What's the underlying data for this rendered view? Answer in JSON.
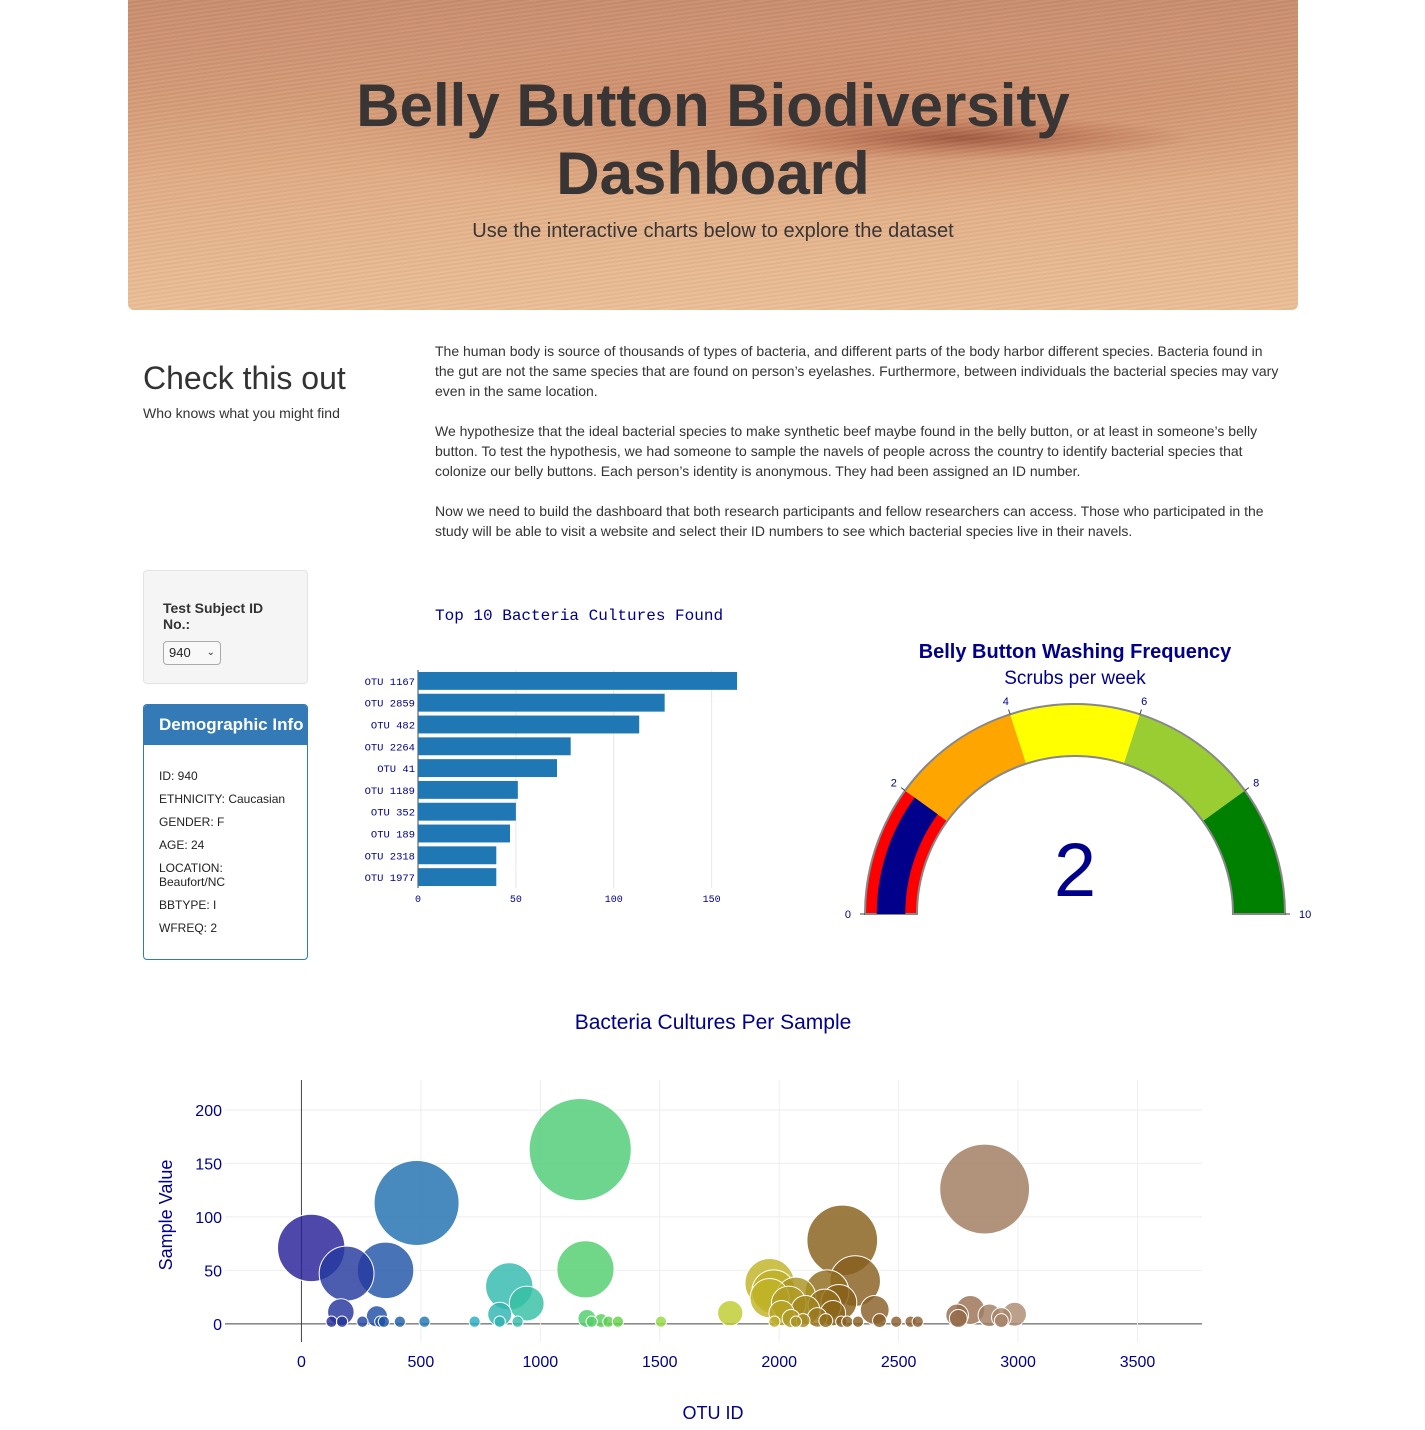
{
  "hero": {
    "title_line1": "Belly Button Biodiversity",
    "title_line2": "Dashboard",
    "subtitle": "Use the interactive charts below to explore the dataset"
  },
  "intro": {
    "heading": "Check this out",
    "subheading": "Who knows what you might find",
    "paragraphs": [
      "The human body is source of thousands of types of bacteria, and different parts of the body harbor different species. Bacteria found in the gut are not the same species that are found on person’s eyelashes. Furthermore, between individuals the bacterial species may vary even in the same location.",
      "We hypothesize that the ideal bacterial species to make synthetic beef maybe found in the belly button, or at least in someone’s belly button. To test the hypothesis, we had someone to sample the navels of people across the country to identify bacterial species that colonize our belly buttons. Each person’s identity is anonymous. They had been assigned an ID number.",
      "Now we need to build the dashboard that both research participants and fellow researchers can access. Those who participated in the study will be able to visit a website and select their ID numbers to see which bacterial species live in their navels."
    ]
  },
  "selector": {
    "label": "Test Subject ID No.:",
    "selected": "940"
  },
  "demographics": {
    "title": "Demographic Info",
    "items": [
      "ID: 940",
      "ETHNICITY: Caucasian",
      "GENDER: F",
      "AGE: 24",
      "LOCATION: Beaufort/NC",
      "BBTYPE: I",
      "WFREQ: 2"
    ]
  },
  "colors": {
    "bar": "#1f77b4",
    "chart_title": "#00008b",
    "panel": "#337ab7"
  },
  "chart_data": [
    {
      "type": "bar",
      "orientation": "horizontal",
      "title": "Top 10 Bacteria Cultures Found",
      "categories": [
        "OTU 1167",
        "OTU 2859",
        "OTU 482",
        "OTU 2264",
        "OTU 41",
        "OTU 1189",
        "OTU 352",
        "OTU 189",
        "OTU 2318",
        "OTU 1977"
      ],
      "values": [
        163,
        126,
        113,
        78,
        71,
        51,
        50,
        47,
        40,
        40
      ],
      "xlim": [
        0,
        165
      ],
      "xticks": [
        0,
        50,
        100,
        150
      ]
    },
    {
      "type": "gauge",
      "title": "Belly Button Washing Frequency",
      "subtitle": "Scrubs per week",
      "value": 2,
      "range": [
        0,
        10
      ],
      "ticks": [
        0,
        2,
        4,
        6,
        8,
        10
      ],
      "steps": [
        {
          "range": [
            0,
            2
          ],
          "color": "#ff0000"
        },
        {
          "range": [
            2,
            4
          ],
          "color": "#ffa500"
        },
        {
          "range": [
            4,
            6
          ],
          "color": "#ffff00"
        },
        {
          "range": [
            6,
            8
          ],
          "color": "#9acd32"
        },
        {
          "range": [
            8,
            10
          ],
          "color": "#008000"
        }
      ],
      "bar_color": "#00008b"
    },
    {
      "type": "scatter",
      "title": "Bacteria Cultures Per Sample",
      "xlabel": "OTU ID",
      "ylabel": "Sample Value",
      "xlim": [
        -320,
        3770
      ],
      "ylim": [
        -17,
        228
      ],
      "xticks": [
        0,
        500,
        1000,
        1500,
        2000,
        2500,
        3000,
        3500
      ],
      "yticks": [
        0,
        50,
        100,
        150,
        200
      ],
      "points": [
        {
          "x": 41,
          "y": 71
        },
        {
          "x": 189,
          "y": 47
        },
        {
          "x": 352,
          "y": 50
        },
        {
          "x": 482,
          "y": 113
        },
        {
          "x": 165,
          "y": 11
        },
        {
          "x": 316,
          "y": 7
        },
        {
          "x": 126,
          "y": 2
        },
        {
          "x": 170,
          "y": 2
        },
        {
          "x": 255,
          "y": 2
        },
        {
          "x": 330,
          "y": 2
        },
        {
          "x": 345,
          "y": 2
        },
        {
          "x": 412,
          "y": 2
        },
        {
          "x": 515,
          "y": 2
        },
        {
          "x": 725,
          "y": 2
        },
        {
          "x": 830,
          "y": 9
        },
        {
          "x": 870,
          "y": 35
        },
        {
          "x": 943,
          "y": 19
        },
        {
          "x": 830,
          "y": 2
        },
        {
          "x": 905,
          "y": 2
        },
        {
          "x": 1167,
          "y": 163
        },
        {
          "x": 1189,
          "y": 51
        },
        {
          "x": 1195,
          "y": 5
        },
        {
          "x": 1215,
          "y": 2
        },
        {
          "x": 1255,
          "y": 3
        },
        {
          "x": 1285,
          "y": 2
        },
        {
          "x": 1325,
          "y": 2
        },
        {
          "x": 1505,
          "y": 2
        },
        {
          "x": 1795,
          "y": 10
        },
        {
          "x": 1960,
          "y": 38
        },
        {
          "x": 1977,
          "y": 30
        },
        {
          "x": 1960,
          "y": 24
        },
        {
          "x": 2040,
          "y": 19
        },
        {
          "x": 2070,
          "y": 25
        },
        {
          "x": 2110,
          "y": 13
        },
        {
          "x": 2010,
          "y": 10
        },
        {
          "x": 2050,
          "y": 5
        },
        {
          "x": 2100,
          "y": 3
        },
        {
          "x": 1980,
          "y": 2
        },
        {
          "x": 2070,
          "y": 2
        },
        {
          "x": 2264,
          "y": 78
        },
        {
          "x": 2318,
          "y": 40
        },
        {
          "x": 2200,
          "y": 30
        },
        {
          "x": 2250,
          "y": 20
        },
        {
          "x": 2190,
          "y": 17
        },
        {
          "x": 2225,
          "y": 10
        },
        {
          "x": 2160,
          "y": 6
        },
        {
          "x": 2195,
          "y": 3
        },
        {
          "x": 2260,
          "y": 2
        },
        {
          "x": 2285,
          "y": 2
        },
        {
          "x": 2330,
          "y": 2
        },
        {
          "x": 2400,
          "y": 13
        },
        {
          "x": 2420,
          "y": 3
        },
        {
          "x": 2490,
          "y": 2
        },
        {
          "x": 2550,
          "y": 2
        },
        {
          "x": 2580,
          "y": 2
        },
        {
          "x": 2745,
          "y": 8
        },
        {
          "x": 2800,
          "y": 13
        },
        {
          "x": 2860,
          "y": 126
        },
        {
          "x": 2880,
          "y": 8
        },
        {
          "x": 2930,
          "y": 6
        },
        {
          "x": 2985,
          "y": 9
        },
        {
          "x": 2750,
          "y": 5
        },
        {
          "x": 2930,
          "y": 3
        }
      ]
    }
  ]
}
